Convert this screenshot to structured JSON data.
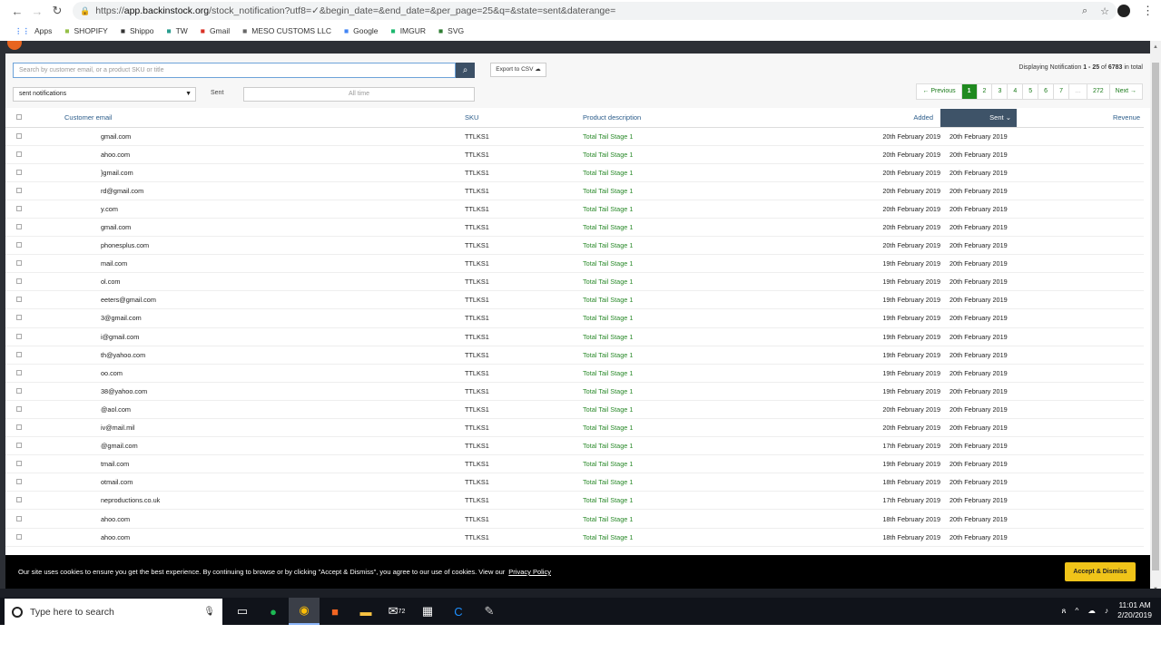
{
  "browser": {
    "url_host": "app.backinstock.org",
    "url_path": "/stock_notification?utf8=✓&begin_date=&end_date=&per_page=25&q=&state=sent&daterange=",
    "url_scheme": "https://",
    "bookmarks": [
      {
        "label": "Apps",
        "icon": "apps-grid-icon",
        "color": "#4285f4"
      },
      {
        "label": "SHOPIFY",
        "icon": "shopify-icon",
        "color": "#95bf47"
      },
      {
        "label": "Shippo",
        "icon": "shippo-icon",
        "color": "#333333"
      },
      {
        "label": "TW",
        "icon": "tw-icon",
        "color": "#2a9d8f"
      },
      {
        "label": "Gmail",
        "icon": "gmail-icon",
        "color": "#d93025"
      },
      {
        "label": "MESO CUSTOMS LLC",
        "icon": "page-icon",
        "color": "#666666"
      },
      {
        "label": "Google",
        "icon": "google-icon",
        "color": "#4285f4"
      },
      {
        "label": "IMGUR",
        "icon": "imgur-icon",
        "color": "#1bb76e"
      },
      {
        "label": "SVG",
        "icon": "svg-icon",
        "color": "#2e7d32"
      }
    ]
  },
  "toolbar": {
    "search_placeholder": "Search by customer email, or a product SKU or title",
    "export_label": "Export to CSV",
    "displaying_prefix": "Displaying Notification ",
    "displaying_range": "1 - 25",
    "displaying_of": " of ",
    "displaying_total": "6783",
    "displaying_suffix": " in total",
    "filter_selected": "sent notifications",
    "sent_label": "Sent",
    "daterange_placeholder": "All time"
  },
  "pagination": [
    "← Previous",
    "1",
    "2",
    "3",
    "4",
    "5",
    "6",
    "7",
    "…",
    "272",
    "Next →"
  ],
  "table": {
    "headers": {
      "email": "Customer email",
      "sku": "SKU",
      "desc": "Product description",
      "added": "Added",
      "sent": "Sent",
      "revenue": "Revenue"
    },
    "rows": [
      {
        "email": "gmail.com",
        "sku": "TTLKS1",
        "desc": "Total Tail Stage 1",
        "added": "20th February 2019",
        "sent": "20th February 2019"
      },
      {
        "email": "ahoo.com",
        "sku": "TTLKS1",
        "desc": "Total Tail Stage 1",
        "added": "20th February 2019",
        "sent": "20th February 2019"
      },
      {
        "email": "}gmail.com",
        "sku": "TTLKS1",
        "desc": "Total Tail Stage 1",
        "added": "20th February 2019",
        "sent": "20th February 2019"
      },
      {
        "email": "rd@gmail.com",
        "sku": "TTLKS1",
        "desc": "Total Tail Stage 1",
        "added": "20th February 2019",
        "sent": "20th February 2019"
      },
      {
        "email": "y.com",
        "sku": "TTLKS1",
        "desc": "Total Tail Stage 1",
        "added": "20th February 2019",
        "sent": "20th February 2019"
      },
      {
        "email": "gmail.com",
        "sku": "TTLKS1",
        "desc": "Total Tail Stage 1",
        "added": "20th February 2019",
        "sent": "20th February 2019"
      },
      {
        "email": "phonesplus.com",
        "sku": "TTLKS1",
        "desc": "Total Tail Stage 1",
        "added": "20th February 2019",
        "sent": "20th February 2019"
      },
      {
        "email": "mail.com",
        "sku": "TTLKS1",
        "desc": "Total Tail Stage 1",
        "added": "19th February 2019",
        "sent": "20th February 2019"
      },
      {
        "email": "ol.com",
        "sku": "TTLKS1",
        "desc": "Total Tail Stage 1",
        "added": "19th February 2019",
        "sent": "20th February 2019"
      },
      {
        "email": "eeters@gmail.com",
        "sku": "TTLKS1",
        "desc": "Total Tail Stage 1",
        "added": "19th February 2019",
        "sent": "20th February 2019"
      },
      {
        "email": "3@gmail.com",
        "sku": "TTLKS1",
        "desc": "Total Tail Stage 1",
        "added": "19th February 2019",
        "sent": "20th February 2019"
      },
      {
        "email": "i@gmail.com",
        "sku": "TTLKS1",
        "desc": "Total Tail Stage 1",
        "added": "19th February 2019",
        "sent": "20th February 2019"
      },
      {
        "email": "th@yahoo.com",
        "sku": "TTLKS1",
        "desc": "Total Tail Stage 1",
        "added": "19th February 2019",
        "sent": "20th February 2019"
      },
      {
        "email": "oo.com",
        "sku": "TTLKS1",
        "desc": "Total Tail Stage 1",
        "added": "19th February 2019",
        "sent": "20th February 2019"
      },
      {
        "email": "38@yahoo.com",
        "sku": "TTLKS1",
        "desc": "Total Tail Stage 1",
        "added": "19th February 2019",
        "sent": "20th February 2019"
      },
      {
        "email": "@aol.com",
        "sku": "TTLKS1",
        "desc": "Total Tail Stage 1",
        "added": "20th February 2019",
        "sent": "20th February 2019"
      },
      {
        "email": "iv@mail.mil",
        "sku": "TTLKS1",
        "desc": "Total Tail Stage 1",
        "added": "20th February 2019",
        "sent": "20th February 2019"
      },
      {
        "email": "@gmail.com",
        "sku": "TTLKS1",
        "desc": "Total Tail Stage 1",
        "added": "17th February 2019",
        "sent": "20th February 2019"
      },
      {
        "email": "tmail.com",
        "sku": "TTLKS1",
        "desc": "Total Tail Stage 1",
        "added": "19th February 2019",
        "sent": "20th February 2019"
      },
      {
        "email": "otmail.com",
        "sku": "TTLKS1",
        "desc": "Total Tail Stage 1",
        "added": "18th February 2019",
        "sent": "20th February 2019"
      },
      {
        "email": "neproductions.co.uk",
        "sku": "TTLKS1",
        "desc": "Total Tail Stage 1",
        "added": "17th February 2019",
        "sent": "20th February 2019"
      },
      {
        "email": "ahoo.com",
        "sku": "TTLKS1",
        "desc": "Total Tail Stage 1",
        "added": "18th February 2019",
        "sent": "20th February 2019"
      },
      {
        "email": "ahoo.com",
        "sku": "TTLKS1",
        "desc": "Total Tail Stage 1",
        "added": "18th February 2019",
        "sent": "20th February 2019"
      }
    ]
  },
  "cookie": {
    "message": "Our site uses cookies to ensure you get the best experience. By continuing to browse or by clicking \"Accept & Dismiss\", you agree to our use of cookies. View our",
    "link": "Privacy Policy",
    "accept": "Accept & Dismiss"
  },
  "taskbar": {
    "search_placeholder": "Type here to search",
    "mail_badge": "72",
    "time": "11:01 AM",
    "date": "2/20/2019"
  },
  "colors": {
    "accent_green": "#1f8a1f",
    "header_sorted": "#3e5368",
    "cookie_button": "#f0c419"
  }
}
